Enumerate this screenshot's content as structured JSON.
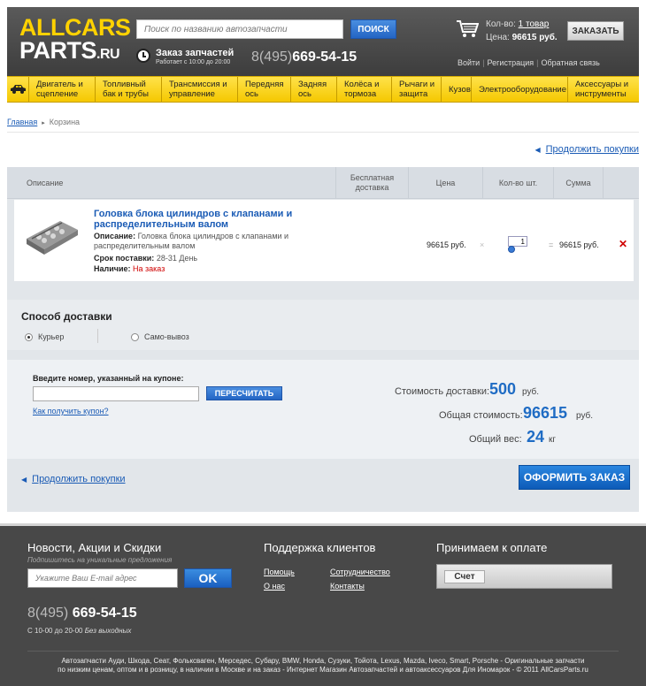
{
  "header": {
    "logo_top": "ALLCARS",
    "logo_bottom": "PARTS",
    "logo_tld": ".RU",
    "search_placeholder": "Поиск по названию автозапчасти",
    "search_button": "ПОИСК",
    "order_title": "Заказ запчастей",
    "order_hours": "Работает с 10:00 до 20:00",
    "phone_code": "8(495)",
    "phone_number": "669-54-15",
    "cart_count_label": "Кол-во:",
    "cart_count_value": "1 товар",
    "cart_price_label": "Цена:",
    "cart_price_value": "96615 руб.",
    "order_button": "ЗАКАЗАТЬ",
    "links": [
      "Войти",
      "Регистрация",
      "Обратная связь"
    ]
  },
  "nav": {
    "items": [
      "Двигатель и сцепление",
      "Топливный бак и трубы",
      "Трансмиссия и управление",
      "Передняя ось",
      "Задняя ось",
      "Колёса и тормоза",
      "Рычаги и защита",
      "Кузов",
      "Электрооборудование",
      "Аксессуары и инструменты"
    ]
  },
  "breadcrumb": {
    "home": "Главная",
    "current": "Корзина"
  },
  "continue_label": "Продолжить покупки",
  "table": {
    "headers": {
      "description": "Описание",
      "free_delivery": "Бесплатная доставка",
      "price": "Цена",
      "qty": "Кол-во шт.",
      "sum": "Сумма"
    }
  },
  "item": {
    "name": "Головка блока цилиндров с клапанами и распределительным валом",
    "desc_label": "Описание:",
    "desc_text": "Головка блока цилиндров с клапанами и распределительным валом",
    "delivery_label": "Срок поставки:",
    "delivery_text": "28-31 День",
    "avail_label": "Наличие:",
    "avail_text": "На заказ",
    "price": "96615 руб.",
    "times": "×",
    "qty": "1",
    "equals": "=",
    "sum": "96615 руб.",
    "remove": "✕"
  },
  "delivery": {
    "title": "Способ доставки",
    "options": [
      "Курьер",
      "Само-вывоз"
    ],
    "selected": "Курьер"
  },
  "coupon": {
    "label": "Введите номер, указанный на купоне:",
    "button": "ПЕРЕСЧИТАТЬ",
    "link": "Как получить купон?"
  },
  "totals": {
    "delivery_label": "Стоимость доставки:",
    "delivery_value": "500",
    "delivery_unit": "руб.",
    "total_label": "Общая стоимость:",
    "total_value": "96615",
    "total_unit": "руб.",
    "weight_label": "Общий вес:",
    "weight_value": "24",
    "weight_unit": "кг"
  },
  "checkout_button": "ОФОРМИТЬ ЗАКАЗ",
  "footer": {
    "news_title": "Новости, Акции и Скидки",
    "news_sub": "Подпишитесь на уникальные предложения",
    "email_placeholder": "Укажите Ваш E-mail адрес",
    "ok_button": "OK",
    "support_title": "Поддержка клиентов",
    "support_links": [
      "Помощь",
      "Сотрудничество",
      "О нас",
      "Контакты"
    ],
    "payment_title": "Принимаем к оплате",
    "payment_method": "Счет",
    "phone_code": "8(495)",
    "phone_number": "669-54-15",
    "hours": "С 10-00 до 20-00",
    "hours_note": "Без выходных",
    "copyright_1": "Автозапчасти Ауди, Шкода, Сеат, Фольксваген, Мерседес, Субару, BMW, Honda, Сузуки, Тойота, Lexus, Mazda, Iveco, Smart, Porsche - Оригинальные запчасти",
    "copyright_2": "по низким ценам, оптом и в розницу, в наличии в Москве и на заказ - Интернет Магазин Автозапчастей и автоаксессуаров Для Иномарок - © 2011 AllCarsParts.ru"
  }
}
